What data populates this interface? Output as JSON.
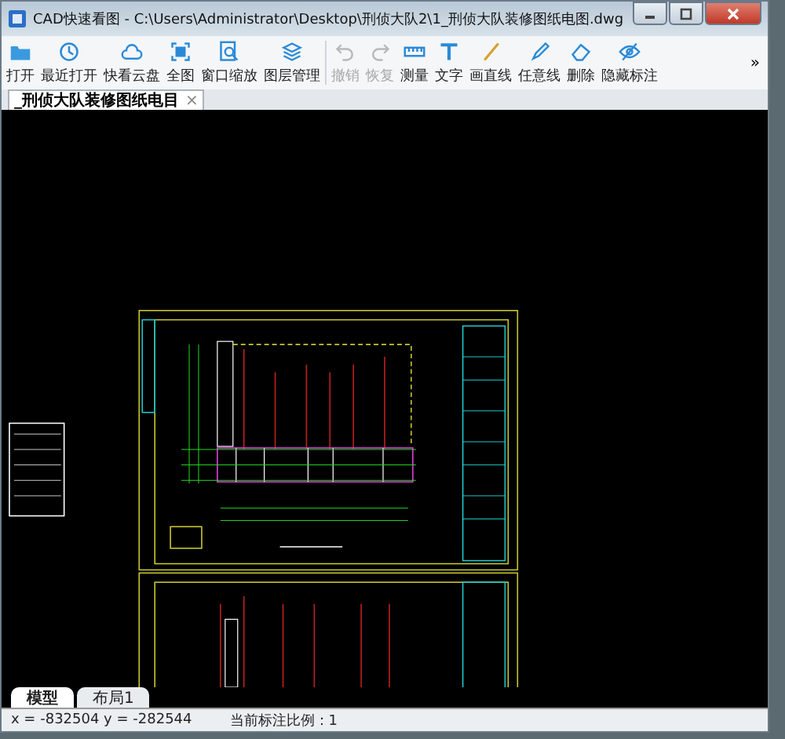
{
  "window": {
    "title": "CAD快速看图 - C:\\Users\\Administrator\\Desktop\\刑侦大队2\\1_刑侦大队装修图纸电图.dwg"
  },
  "toolbar": [
    {
      "label": "打开",
      "disabled": false
    },
    {
      "label": "最近打开",
      "disabled": false
    },
    {
      "label": "快看云盘",
      "disabled": false
    },
    {
      "label": "全图",
      "disabled": false
    },
    {
      "label": "窗口缩放",
      "disabled": false
    },
    {
      "label": "图层管理",
      "disabled": false
    },
    {
      "label": "撤销",
      "disabled": true
    },
    {
      "label": "恢复",
      "disabled": true
    },
    {
      "label": "测量",
      "disabled": false
    },
    {
      "label": "文字",
      "disabled": false
    },
    {
      "label": "画直线",
      "disabled": false
    },
    {
      "label": "任意线",
      "disabled": false
    },
    {
      "label": "删除",
      "disabled": false
    },
    {
      "label": "隐藏标注",
      "disabled": false
    }
  ],
  "toolbar_more": "»",
  "document_tabs": [
    {
      "label": "_刑侦大队装修图纸电目",
      "selected": true,
      "close": "×"
    }
  ],
  "layout_tabs": [
    {
      "label": "模型",
      "selected": true
    },
    {
      "label": "布局1",
      "selected": false
    }
  ],
  "status_bar": {
    "coordinates": "x = -832504  y = -282544",
    "scale": "当前标注比例：1"
  }
}
